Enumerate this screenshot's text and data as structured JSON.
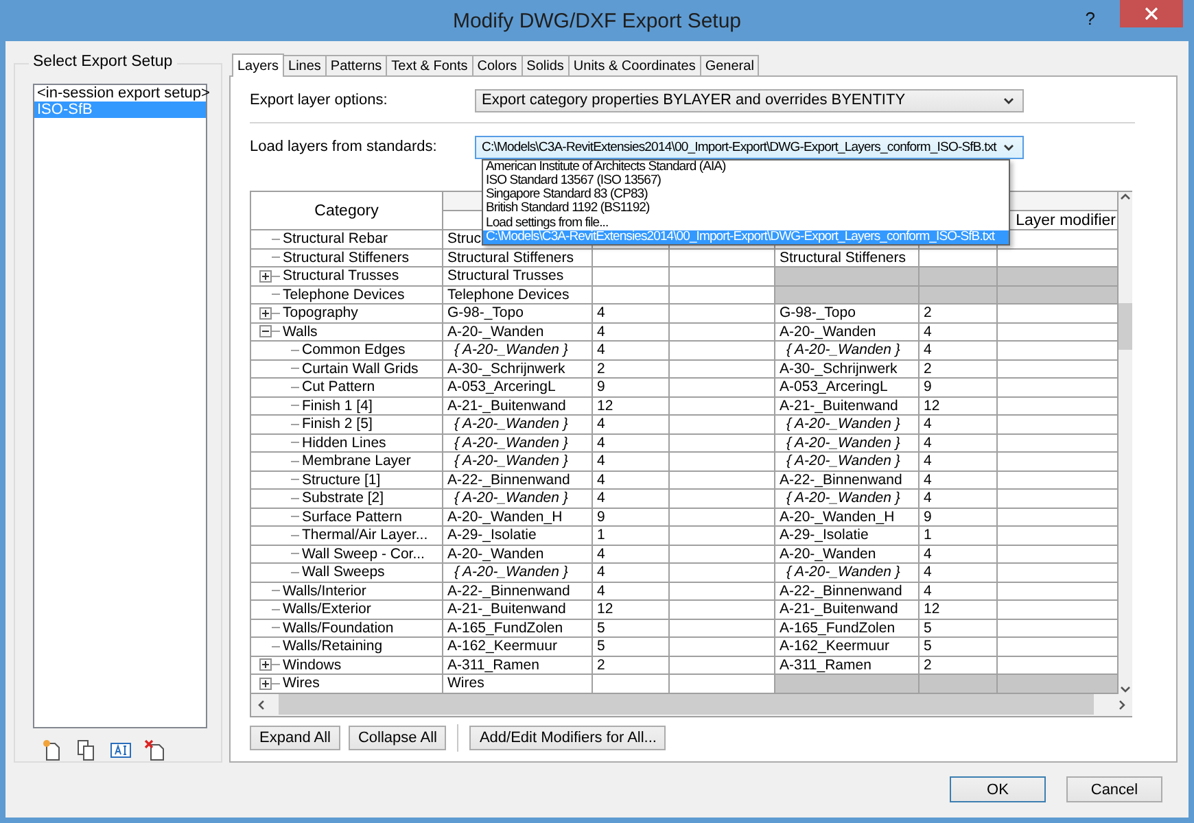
{
  "window": {
    "title": "Modify DWG/DXF Export Setup",
    "help": "?"
  },
  "setups": {
    "label": "Select Export Setup",
    "items": [
      {
        "label": "<in-session export setup>",
        "selected": false
      },
      {
        "label": "ISO-SfB",
        "selected": true
      }
    ]
  },
  "tabs": [
    {
      "label": "Layers",
      "selected": true
    },
    {
      "label": "Lines",
      "selected": false
    },
    {
      "label": "Patterns",
      "selected": false
    },
    {
      "label": "Text & Fonts",
      "selected": false
    },
    {
      "label": "Colors",
      "selected": false
    },
    {
      "label": "Solids",
      "selected": false
    },
    {
      "label": "Units & Coordinates",
      "selected": false
    },
    {
      "label": "General",
      "selected": false
    }
  ],
  "export_layer_options": {
    "label": "Export layer options:",
    "value": "Export category properties BYLAYER and overrides BYENTITY"
  },
  "load_layers": {
    "label": "Load layers from standards:",
    "value": "C:\\Models\\C3A-RevitExtensies2014\\00_Import-Export\\DWG-Export_Layers_conform_ISO-SfB.txt",
    "options": [
      {
        "label": "American Institute of Architects Standard (AIA)",
        "selected": false
      },
      {
        "label": "ISO Standard 13567 (ISO 13567)",
        "selected": false
      },
      {
        "label": "Singapore Standard 83 (CP83)",
        "selected": false
      },
      {
        "label": "British Standard 1192 (BS1192)",
        "selected": false
      },
      {
        "label": "Load settings from file...",
        "selected": false
      },
      {
        "label": "C:\\Models\\C3A-RevitExtensies2014\\00_Import-Export\\DWG-Export_Layers_conform_ISO-SfB.txt",
        "selected": true
      }
    ]
  },
  "table": {
    "category_header": "Category",
    "modifier_header": "Layer modifier",
    "rows": [
      {
        "category": "Structural Rebar",
        "column_2": "Struc",
        "inherited": false,
        "cut_disabled": false
      },
      {
        "category": "Structural Stiffeners",
        "column_2": "Structural Stiffeners",
        "column_5": "Structural Stiffeners",
        "inherited": false,
        "cut_disabled": false
      },
      {
        "category": "Structural Trusses",
        "column_2": "Structural Trusses",
        "inherited": false,
        "cut_disabled": true,
        "expanded": false
      },
      {
        "category": "Telephone Devices",
        "column_2": "Telephone Devices",
        "inherited": false,
        "cut_disabled": true
      },
      {
        "category": "Topography",
        "column_2": "G-98-_Topo",
        "column_3": "4",
        "column_5": "G-98-_Topo",
        "column_6": "2",
        "inherited": false,
        "cut_disabled": false,
        "expanded": false
      },
      {
        "category": "Walls",
        "column_2": "A-20-_Wanden",
        "column_3": "4",
        "column_5": "A-20-_Wanden",
        "column_6": "4",
        "inherited": false,
        "cut_disabled": false,
        "expanded": true,
        "children": [
          {
            "category": "Common Edges",
            "column_2": "{ A-20-_Wanden }",
            "column_3": "4",
            "column_5": "{ A-20-_Wanden }",
            "column_6": "4",
            "inherited": true,
            "cut_disabled": false
          },
          {
            "category": "Curtain Wall Grids",
            "column_2": "A-30-_Schrijnwerk",
            "column_3": "2",
            "column_5": "A-30-_Schrijnwerk",
            "column_6": "2",
            "inherited": false,
            "cut_disabled": false
          },
          {
            "category": "Cut Pattern",
            "column_2": "A-053_ArceringL",
            "column_3": "9",
            "column_5": "A-053_ArceringL",
            "column_6": "9",
            "inherited": false,
            "cut_disabled": false
          },
          {
            "category": "Finish 1 [4]",
            "column_2": "A-21-_Buitenwand",
            "column_3": "12",
            "column_5": "A-21-_Buitenwand",
            "column_6": "12",
            "inherited": false,
            "cut_disabled": false
          },
          {
            "category": "Finish 2 [5]",
            "column_2": "{ A-20-_Wanden }",
            "column_3": "4",
            "column_5": "{ A-20-_Wanden }",
            "column_6": "4",
            "inherited": true,
            "cut_disabled": false
          },
          {
            "category": "Hidden Lines",
            "column_2": "{ A-20-_Wanden }",
            "column_3": "4",
            "column_5": "{ A-20-_Wanden }",
            "column_6": "4",
            "inherited": true,
            "cut_disabled": false
          },
          {
            "category": "Membrane Layer",
            "column_2": "{ A-20-_Wanden }",
            "column_3": "4",
            "column_5": "{ A-20-_Wanden }",
            "column_6": "4",
            "inherited": true,
            "cut_disabled": false
          },
          {
            "category": "Structure [1]",
            "column_2": "A-22-_Binnenwand",
            "column_3": "4",
            "column_5": "A-22-_Binnenwand",
            "column_6": "4",
            "inherited": false,
            "cut_disabled": false
          },
          {
            "category": "Substrate [2]",
            "column_2": "{ A-20-_Wanden }",
            "column_3": "4",
            "column_5": "{ A-20-_Wanden }",
            "column_6": "4",
            "inherited": true,
            "cut_disabled": false
          },
          {
            "category": "Surface Pattern",
            "column_2": "A-20-_Wanden_H",
            "column_3": "9",
            "column_5": "A-20-_Wanden_H",
            "column_6": "9",
            "inherited": false,
            "cut_disabled": false
          },
          {
            "category": "Thermal/Air Layer...",
            "column_2": "A-29-_Isolatie",
            "column_3": "1",
            "column_5": "A-29-_Isolatie",
            "column_6": "1",
            "inherited": false,
            "cut_disabled": false
          },
          {
            "category": "Wall Sweep - Cor...",
            "column_2": "A-20-_Wanden",
            "column_3": "4",
            "column_5": "A-20-_Wanden",
            "column_6": "4",
            "inherited": false,
            "cut_disabled": false
          },
          {
            "category": "Wall Sweeps",
            "column_2": "{ A-20-_Wanden }",
            "column_3": "4",
            "column_5": "{ A-20-_Wanden }",
            "column_6": "4",
            "inherited": true,
            "cut_disabled": false
          }
        ]
      },
      {
        "category": "Walls/Interior",
        "column_2": "A-22-_Binnenwand",
        "column_3": "4",
        "column_5": "A-22-_Binnenwand",
        "column_6": "4",
        "inherited": false,
        "cut_disabled": false
      },
      {
        "category": "Walls/Exterior",
        "column_2": "A-21-_Buitenwand",
        "column_3": "12",
        "column_5": "A-21-_Buitenwand",
        "column_6": "12",
        "inherited": false,
        "cut_disabled": false
      },
      {
        "category": "Walls/Foundation",
        "column_2": "A-165_FundZolen",
        "column_3": "5",
        "column_5": "A-165_FundZolen",
        "column_6": "5",
        "inherited": false,
        "cut_disabled": false
      },
      {
        "category": "Walls/Retaining",
        "column_2": "A-162_Keermuur",
        "column_3": "5",
        "column_5": "A-162_Keermuur",
        "column_6": "5",
        "inherited": false,
        "cut_disabled": false
      },
      {
        "category": "Windows",
        "column_2": "A-311_Ramen",
        "column_3": "2",
        "column_5": "A-311_Ramen",
        "column_6": "2",
        "inherited": false,
        "cut_disabled": false,
        "expanded": false
      },
      {
        "category": "Wires",
        "column_2": "Wires",
        "inherited": false,
        "cut_disabled": true,
        "expanded": false
      }
    ]
  },
  "table_buttons": [
    "Expand All",
    "Collapse All",
    "Add/Edit Modifiers for All..."
  ],
  "dialog_buttons": [
    {
      "label": "OK",
      "default": true
    },
    {
      "label": "Cancel",
      "default": false
    }
  ]
}
